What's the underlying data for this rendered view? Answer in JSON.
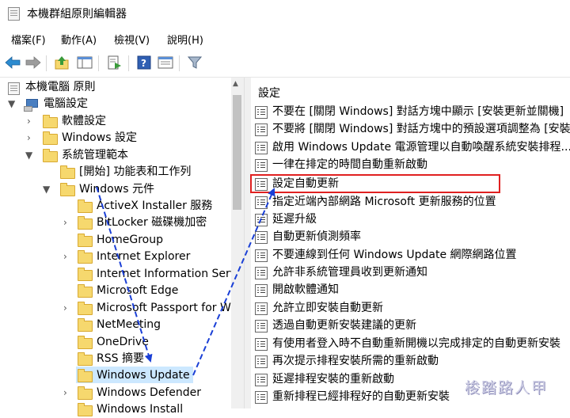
{
  "window": {
    "title": "本機群組原則編輯器"
  },
  "menubar": {
    "items": [
      "檔案(F)",
      "動作(A)",
      "檢視(V)",
      "說明(H)"
    ]
  },
  "tree": {
    "root": "本機電腦 原則",
    "computer_config": "電腦設定",
    "software_settings": "軟體設定",
    "windows_settings": "Windows 設定",
    "admin_templates": "系統管理範本",
    "control_panel": "[開始] 功能表和工作列",
    "windows_components": "Windows 元件",
    "components": [
      "ActiveX Installer 服務",
      "BitLocker 磁碟機加密",
      "HomeGroup",
      "Internet Explorer",
      "Internet Information Servi",
      "Microsoft Edge",
      "Microsoft Passport for W",
      "NetMeeting",
      "OneDrive",
      "RSS 摘要",
      "Windows Update",
      "Windows Defender",
      "Windows Install"
    ]
  },
  "list": {
    "header": "設定",
    "items": [
      "不要在 [關閉 Windows] 對話方塊中顯示 [安裝更新並關機]",
      "不要將 [關閉 Windows] 對話方塊中的預設選項調整為 [安裝",
      "啟用 Windows Update 電源管理以自動喚醒系統安裝排程...",
      "一律在排定的時間自動重新啟動",
      "設定自動更新",
      "指定近端內部網路 Microsoft 更新服務的位置",
      "延遲升級",
      "自動更新偵測頻率",
      "不要連線到任何 Windows Update 網際網路位置",
      "允許非系統管理員收到更新通知",
      "開啟軟體通知",
      "允許立即安裝自動更新",
      "透過自動更新安裝建議的更新",
      "有使用者登入時不自動重新開機以完成排定的自動更新安裝",
      "再次提示排程安裝所需的重新啟動",
      "延遲排程安裝的重新啟動",
      "重新排程已經排程好的自動更新安裝"
    ],
    "highlighted_index": 4
  },
  "watermark": "梭踏路人甲",
  "colors": {
    "highlight_border": "#e02020",
    "annotation_line": "#1a3fd6",
    "selection": "#cce8ff"
  }
}
